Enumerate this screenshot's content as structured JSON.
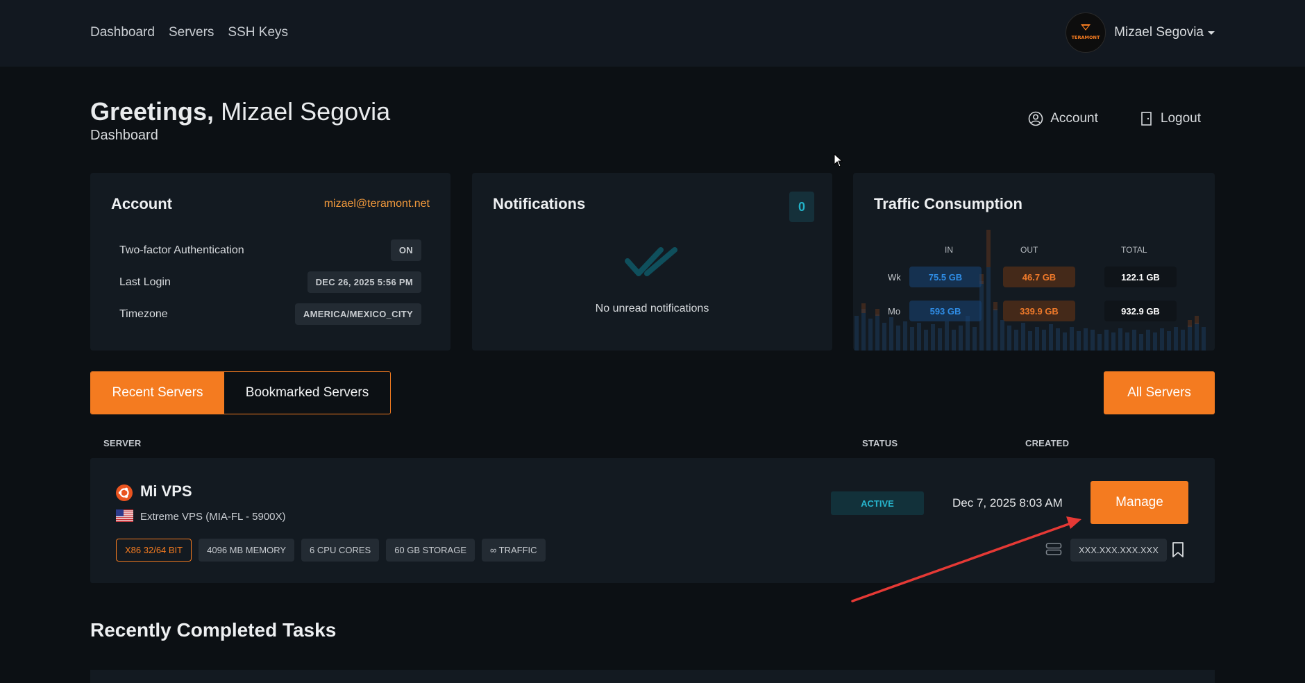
{
  "nav": {
    "links": [
      "Dashboard",
      "Servers",
      "SSH Keys"
    ],
    "user_name": "Mizael Segovia",
    "logo_text": "TERAMONT"
  },
  "header": {
    "greeting_bold": "Greetings,",
    "greeting_name": "Mizael Segovia",
    "subtitle": "Dashboard",
    "account_label": "Account",
    "logout_label": "Logout"
  },
  "account_card": {
    "title": "Account",
    "email": "mizael@teramont.net",
    "rows": [
      {
        "label": "Two-factor Authentication",
        "value": "ON"
      },
      {
        "label": "Last Login",
        "value": "DEC 26, 2025 5:56 PM"
      },
      {
        "label": "Timezone",
        "value": "AMERICA/MEXICO_CITY"
      }
    ]
  },
  "notifications_card": {
    "title": "Notifications",
    "count": "0",
    "empty_text": "No unread notifications"
  },
  "traffic_card": {
    "title": "Traffic Consumption",
    "headers": [
      "IN",
      "OUT",
      "TOTAL"
    ],
    "rows": [
      {
        "label": "Wk",
        "in": "75.5 GB",
        "out": "46.7 GB",
        "total": "122.1 GB"
      },
      {
        "label": "Mo",
        "in": "593 GB",
        "out": "339.9 GB",
        "total": "932.9 GB"
      }
    ]
  },
  "tabs": {
    "recent": "Recent Servers",
    "bookmarked": "Bookmarked Servers",
    "all_servers": "All Servers"
  },
  "table": {
    "col_server": "SERVER",
    "col_status": "STATUS",
    "col_created": "CREATED",
    "servers": [
      {
        "name": "Mi VPS",
        "plan": "Extreme VPS (MIA-FL - 5900X)",
        "specs": [
          "X86 32/64 BIT",
          "4096 MB MEMORY",
          "6 CPU CORES",
          "60 GB STORAGE",
          "∞ TRAFFIC"
        ],
        "status": "ACTIVE",
        "created": "Dec 7, 2025 8:03 AM",
        "manage": "Manage",
        "ip": "XXX.XXX.XXX.XXX"
      }
    ]
  },
  "tasks": {
    "title": "Recently Completed Tasks"
  },
  "colors": {
    "accent": "#f47b20",
    "background": "#0c1014",
    "card": "#131a21",
    "cyan": "#27b4cc",
    "traffic_in": "#2f8de6",
    "traffic_out": "#f07a2a",
    "annotation_arrow": "#e53935"
  }
}
